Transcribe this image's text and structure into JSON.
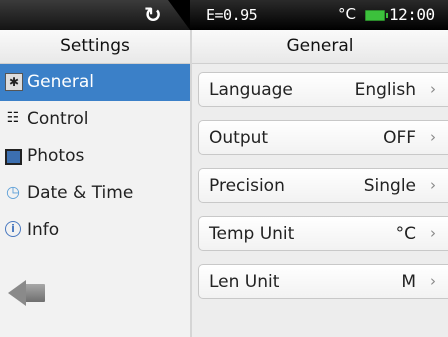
{
  "status_bar": {
    "refresh_icon": "refresh-icon",
    "emissivity": "E=0.95",
    "unit": "°C",
    "battery_icon": "battery-icon",
    "time": "12:00"
  },
  "sidebar": {
    "title": "Settings",
    "items": [
      {
        "label": "General",
        "icon": "gear-icon",
        "active": true
      },
      {
        "label": "Control",
        "icon": "control-icon",
        "active": false
      },
      {
        "label": "Photos",
        "icon": "photo-icon",
        "active": false
      },
      {
        "label": "Date & Time",
        "icon": "clock-icon",
        "active": false
      },
      {
        "label": "Info",
        "icon": "info-icon",
        "active": false
      }
    ],
    "back_icon": "back-arrow-icon"
  },
  "main": {
    "title": "General",
    "settings": [
      {
        "name": "Language",
        "value": "English"
      },
      {
        "name": "Output",
        "value": "OFF"
      },
      {
        "name": "Precision",
        "value": "Single"
      },
      {
        "name": "Temp Unit",
        "value": "°C"
      },
      {
        "name": "Len Unit",
        "value": "M"
      }
    ],
    "chevron": "›"
  },
  "colors": {
    "accent": "#3b80c8",
    "battery": "#3cc13c"
  }
}
